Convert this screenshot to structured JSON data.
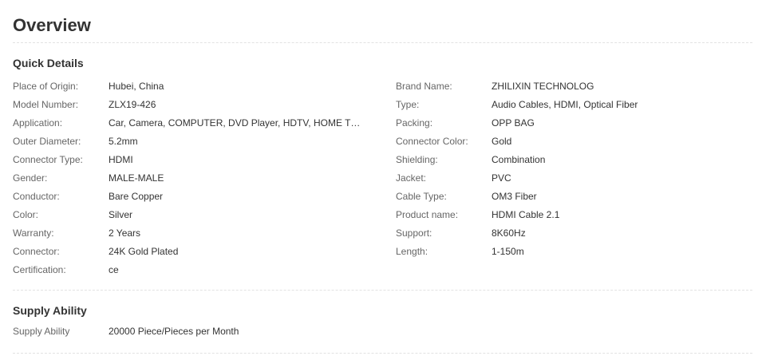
{
  "overview": {
    "title": "Overview"
  },
  "quick_details": {
    "title": "Quick Details",
    "left": [
      {
        "label": "Place of Origin:",
        "value": "Hubei, China"
      },
      {
        "label": "Model Number:",
        "value": "ZLX19-426"
      },
      {
        "label": "Application:",
        "value": "Car, Camera, COMPUTER, DVD Player, HDTV, HOME THEATE..."
      },
      {
        "label": "Outer Diameter:",
        "value": "5.2mm"
      },
      {
        "label": "Connector Type:",
        "value": "HDMI"
      },
      {
        "label": "Gender:",
        "value": "MALE-MALE"
      },
      {
        "label": "Conductor:",
        "value": "Bare Copper"
      },
      {
        "label": "Color:",
        "value": "Silver"
      },
      {
        "label": "Warranty:",
        "value": "2 Years"
      },
      {
        "label": "Connector:",
        "value": "24K Gold Plated"
      },
      {
        "label": "Certification:",
        "value": "ce"
      }
    ],
    "right": [
      {
        "label": "Brand Name:",
        "value": "ZHILIXIN TECHNOLOG"
      },
      {
        "label": "Type:",
        "value": "Audio Cables, HDMI, Optical Fiber"
      },
      {
        "label": "Packing:",
        "value": "OPP BAG"
      },
      {
        "label": "Connector Color:",
        "value": "Gold"
      },
      {
        "label": "Shielding:",
        "value": "Combination"
      },
      {
        "label": "Jacket:",
        "value": "PVC"
      },
      {
        "label": "Cable Type:",
        "value": "OM3 Fiber"
      },
      {
        "label": "Product name:",
        "value": "HDMI Cable 2.1"
      },
      {
        "label": "Support:",
        "value": "8K60Hz"
      },
      {
        "label": "Length:",
        "value": "1-150m"
      }
    ]
  },
  "supply_ability": {
    "title": "Supply Ability",
    "rows": [
      {
        "label": "Supply Ability",
        "value": "20000 Piece/Pieces per Month"
      }
    ]
  }
}
